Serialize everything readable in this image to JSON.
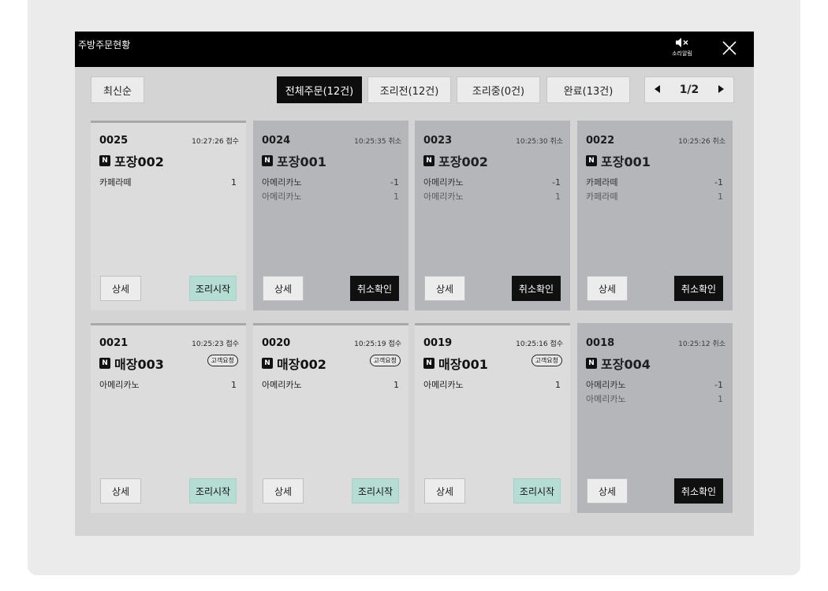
{
  "window": {
    "title": "주방주문현황",
    "sound_label": "소리알림"
  },
  "toolbar": {
    "sort_label": "최신순",
    "tabs": [
      {
        "label": "전체주문(12건)",
        "active": true
      },
      {
        "label": "조리전(12건)",
        "active": false
      },
      {
        "label": "조리중(0건)",
        "active": false
      },
      {
        "label": "완료(13건)",
        "active": false
      }
    ],
    "page": "1/2"
  },
  "buttons": {
    "detail": "상세",
    "start": "조리시작",
    "cancel_confirm": "취소확인"
  },
  "orders": [
    {
      "number": "0025",
      "time": "10:27:26 접수",
      "type": "포장002",
      "status": "received",
      "request": "",
      "items": [
        {
          "name": "카페라떼",
          "qty": "1"
        }
      ]
    },
    {
      "number": "0024",
      "time": "10:25:35 취소",
      "type": "포장001",
      "status": "canceled",
      "request": "",
      "items": [
        {
          "name": "아메리카노",
          "qty": "-1"
        },
        {
          "name": "아메리카노",
          "qty": "1"
        }
      ]
    },
    {
      "number": "0023",
      "time": "10:25:30 취소",
      "type": "포장002",
      "status": "canceled",
      "request": "",
      "items": [
        {
          "name": "아메리카노",
          "qty": "-1"
        },
        {
          "name": "아메리카노",
          "qty": "1"
        }
      ]
    },
    {
      "number": "0022",
      "time": "10:25:26 취소",
      "type": "포장001",
      "status": "canceled",
      "request": "",
      "items": [
        {
          "name": "카페라떼",
          "qty": "-1"
        },
        {
          "name": "카페라떼",
          "qty": "1"
        }
      ]
    },
    {
      "number": "0021",
      "time": "10:25:23 접수",
      "type": "매장003",
      "status": "received",
      "request": "고객요청",
      "items": [
        {
          "name": "아메리카노",
          "qty": "1"
        }
      ]
    },
    {
      "number": "0020",
      "time": "10:25:19 접수",
      "type": "매장002",
      "status": "received",
      "request": "고객요청",
      "items": [
        {
          "name": "아메리카노",
          "qty": "1"
        }
      ]
    },
    {
      "number": "0019",
      "time": "10:25:16 접수",
      "type": "매장001",
      "status": "received",
      "request": "고객요청",
      "items": [
        {
          "name": "아메리카노",
          "qty": "1"
        }
      ]
    },
    {
      "number": "0018",
      "time": "10:25:12 취소",
      "type": "포장004",
      "status": "canceled",
      "request": "",
      "items": [
        {
          "name": "아메리카노",
          "qty": "-1"
        },
        {
          "name": "아메리카노",
          "qty": "1"
        }
      ]
    }
  ]
}
